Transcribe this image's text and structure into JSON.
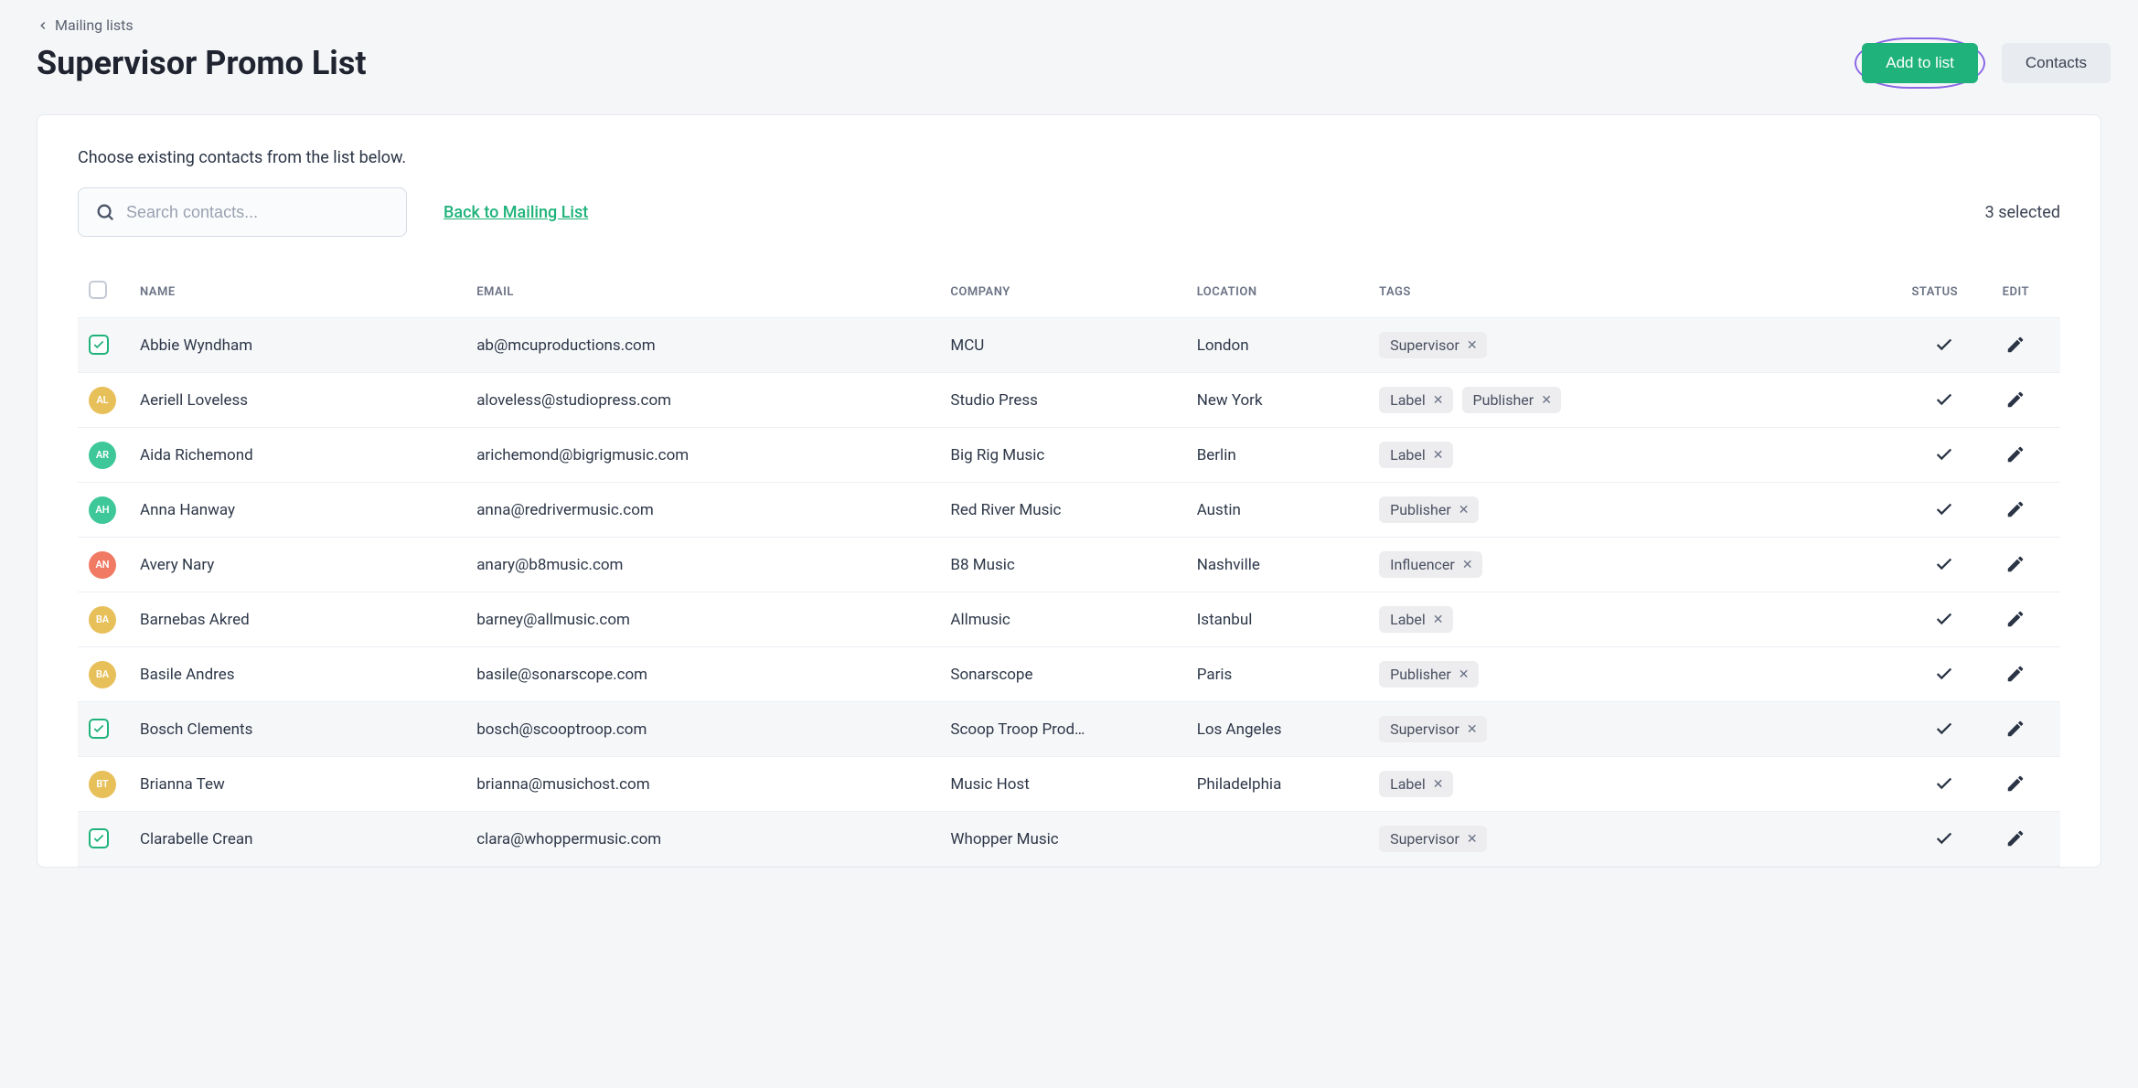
{
  "breadcrumb": {
    "label": "Mailing lists"
  },
  "page_title": "Supervisor Promo List",
  "header": {
    "add_to_list_label": "Add to list",
    "contacts_label": "Contacts"
  },
  "panel": {
    "instruction": "Choose existing contacts from the list below.",
    "search_placeholder": "Search contacts...",
    "back_link": "Back to Mailing List",
    "selected_text": "3 selected"
  },
  "columns": {
    "name": "NAME",
    "email": "EMAIL",
    "company": "COMPANY",
    "location": "LOCATION",
    "tags": "TAGS",
    "status": "STATUS",
    "edit": "EDIT"
  },
  "rows": [
    {
      "selected": true,
      "avatar": null,
      "initials": "",
      "name": "Abbie Wyndham",
      "email": "ab@mcuproductions.com",
      "company": "MCU",
      "location": "London",
      "tags": [
        "Supervisor"
      ]
    },
    {
      "selected": false,
      "avatar": "yellow",
      "initials": "AL",
      "name": "Aeriell Loveless",
      "email": "aloveless@studiopress.com",
      "company": "Studio Press",
      "location": "New York",
      "tags": [
        "Label",
        "Publisher"
      ]
    },
    {
      "selected": false,
      "avatar": "green",
      "initials": "AR",
      "name": "Aida Richemond",
      "email": "arichemond@bigrigmusic.com",
      "company": "Big Rig Music",
      "location": "Berlin",
      "tags": [
        "Label"
      ]
    },
    {
      "selected": false,
      "avatar": "green",
      "initials": "AH",
      "name": "Anna Hanway",
      "email": "anna@redrivermusic.com",
      "company": "Red River Music",
      "location": "Austin",
      "tags": [
        "Publisher"
      ]
    },
    {
      "selected": false,
      "avatar": "coral",
      "initials": "AN",
      "name": "Avery Nary",
      "email": "anary@b8music.com",
      "company": "B8 Music",
      "location": "Nashville",
      "tags": [
        "Influencer"
      ]
    },
    {
      "selected": false,
      "avatar": "yellow",
      "initials": "BA",
      "name": "Barnebas Akred",
      "email": "barney@allmusic.com",
      "company": "Allmusic",
      "location": "Istanbul",
      "tags": [
        "Label"
      ]
    },
    {
      "selected": false,
      "avatar": "yellow",
      "initials": "BA",
      "name": "Basile Andres",
      "email": "basile@sonarscope.com",
      "company": "Sonarscope",
      "location": "Paris",
      "tags": [
        "Publisher"
      ]
    },
    {
      "selected": true,
      "avatar": null,
      "initials": "",
      "name": "Bosch Clements",
      "email": "bosch@scooptroop.com",
      "company": "Scoop Troop Prod…",
      "location": "Los Angeles",
      "tags": [
        "Supervisor"
      ]
    },
    {
      "selected": false,
      "avatar": "yellow",
      "initials": "BT",
      "name": "Brianna Tew",
      "email": "brianna@musichost.com",
      "company": "Music Host",
      "location": "Philadelphia",
      "tags": [
        "Label"
      ]
    },
    {
      "selected": true,
      "avatar": null,
      "initials": "",
      "name": "Clarabelle Crean",
      "email": "clara@whoppermusic.com",
      "company": "Whopper Music",
      "location": "",
      "tags": [
        "Supervisor"
      ]
    }
  ]
}
